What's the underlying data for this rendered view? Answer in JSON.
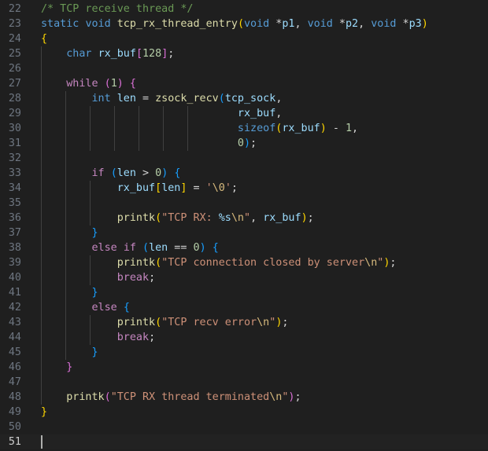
{
  "editor": {
    "language": "C",
    "cursor_line": 51,
    "lines": [
      {
        "number": "22",
        "tokens": [
          {
            "t": "/* TCP receive thread */",
            "c": "c"
          }
        ]
      },
      {
        "number": "23",
        "tokens": [
          {
            "t": "static",
            "c": "k"
          },
          {
            "t": " ",
            "c": "p"
          },
          {
            "t": "void",
            "c": "k"
          },
          {
            "t": " ",
            "c": "p"
          },
          {
            "t": "tcp_rx_thread_entry",
            "c": "f"
          },
          {
            "t": "(",
            "c": "b1"
          },
          {
            "t": "void",
            "c": "k"
          },
          {
            "t": " *",
            "c": "p"
          },
          {
            "t": "p1",
            "c": "v"
          },
          {
            "t": ", ",
            "c": "p"
          },
          {
            "t": "void",
            "c": "k"
          },
          {
            "t": " *",
            "c": "p"
          },
          {
            "t": "p2",
            "c": "v"
          },
          {
            "t": ", ",
            "c": "p"
          },
          {
            "t": "void",
            "c": "k"
          },
          {
            "t": " *",
            "c": "p"
          },
          {
            "t": "p3",
            "c": "v"
          },
          {
            "t": ")",
            "c": "b1"
          }
        ]
      },
      {
        "number": "24",
        "tokens": [
          {
            "t": "{",
            "c": "b1"
          }
        ]
      },
      {
        "number": "25",
        "tokens": [
          {
            "t": "    ",
            "c": "p"
          },
          {
            "t": "char",
            "c": "k"
          },
          {
            "t": " ",
            "c": "p"
          },
          {
            "t": "rx_buf",
            "c": "v"
          },
          {
            "t": "[",
            "c": "b2"
          },
          {
            "t": "128",
            "c": "n"
          },
          {
            "t": "]",
            "c": "b2"
          },
          {
            "t": ";",
            "c": "p"
          }
        ]
      },
      {
        "number": "26",
        "tokens": []
      },
      {
        "number": "27",
        "tokens": [
          {
            "t": "    ",
            "c": "p"
          },
          {
            "t": "while",
            "c": "ctl"
          },
          {
            "t": " ",
            "c": "p"
          },
          {
            "t": "(",
            "c": "b2"
          },
          {
            "t": "1",
            "c": "n"
          },
          {
            "t": ")",
            "c": "b2"
          },
          {
            "t": " ",
            "c": "p"
          },
          {
            "t": "{",
            "c": "b2"
          }
        ]
      },
      {
        "number": "28",
        "tokens": [
          {
            "t": "        ",
            "c": "p"
          },
          {
            "t": "int",
            "c": "k"
          },
          {
            "t": " ",
            "c": "p"
          },
          {
            "t": "len",
            "c": "v"
          },
          {
            "t": " = ",
            "c": "p"
          },
          {
            "t": "zsock_recv",
            "c": "f"
          },
          {
            "t": "(",
            "c": "b3"
          },
          {
            "t": "tcp_sock",
            "c": "v"
          },
          {
            "t": ",",
            "c": "p"
          }
        ]
      },
      {
        "number": "29",
        "tokens": [
          {
            "t": "                               ",
            "c": "p"
          },
          {
            "t": "rx_buf",
            "c": "v"
          },
          {
            "t": ",",
            "c": "p"
          }
        ]
      },
      {
        "number": "30",
        "tokens": [
          {
            "t": "                               ",
            "c": "p"
          },
          {
            "t": "sizeof",
            "c": "k"
          },
          {
            "t": "(",
            "c": "b1"
          },
          {
            "t": "rx_buf",
            "c": "v"
          },
          {
            "t": ")",
            "c": "b1"
          },
          {
            "t": " - ",
            "c": "p"
          },
          {
            "t": "1",
            "c": "n"
          },
          {
            "t": ",",
            "c": "p"
          }
        ]
      },
      {
        "number": "31",
        "tokens": [
          {
            "t": "                               ",
            "c": "p"
          },
          {
            "t": "0",
            "c": "n"
          },
          {
            "t": ")",
            "c": "b3"
          },
          {
            "t": ";",
            "c": "p"
          }
        ]
      },
      {
        "number": "32",
        "tokens": []
      },
      {
        "number": "33",
        "tokens": [
          {
            "t": "        ",
            "c": "p"
          },
          {
            "t": "if",
            "c": "ctl"
          },
          {
            "t": " ",
            "c": "p"
          },
          {
            "t": "(",
            "c": "b3"
          },
          {
            "t": "len",
            "c": "v"
          },
          {
            "t": " > ",
            "c": "p"
          },
          {
            "t": "0",
            "c": "n"
          },
          {
            "t": ")",
            "c": "b3"
          },
          {
            "t": " ",
            "c": "p"
          },
          {
            "t": "{",
            "c": "b3"
          }
        ]
      },
      {
        "number": "34",
        "tokens": [
          {
            "t": "            ",
            "c": "p"
          },
          {
            "t": "rx_buf",
            "c": "v"
          },
          {
            "t": "[",
            "c": "b1"
          },
          {
            "t": "len",
            "c": "v"
          },
          {
            "t": "]",
            "c": "b1"
          },
          {
            "t": " = ",
            "c": "p"
          },
          {
            "t": "'",
            "c": "s"
          },
          {
            "t": "\\0",
            "c": "e"
          },
          {
            "t": "'",
            "c": "s"
          },
          {
            "t": ";",
            "c": "p"
          }
        ]
      },
      {
        "number": "35",
        "tokens": []
      },
      {
        "number": "36",
        "tokens": [
          {
            "t": "            ",
            "c": "p"
          },
          {
            "t": "printk",
            "c": "f"
          },
          {
            "t": "(",
            "c": "b1"
          },
          {
            "t": "\"TCP RX: ",
            "c": "s"
          },
          {
            "t": "%s",
            "c": "v"
          },
          {
            "t": "\\n",
            "c": "e"
          },
          {
            "t": "\"",
            "c": "s"
          },
          {
            "t": ", ",
            "c": "p"
          },
          {
            "t": "rx_buf",
            "c": "v"
          },
          {
            "t": ")",
            "c": "b1"
          },
          {
            "t": ";",
            "c": "p"
          }
        ]
      },
      {
        "number": "37",
        "tokens": [
          {
            "t": "        ",
            "c": "p"
          },
          {
            "t": "}",
            "c": "b3"
          }
        ]
      },
      {
        "number": "38",
        "tokens": [
          {
            "t": "        ",
            "c": "p"
          },
          {
            "t": "else",
            "c": "ctl"
          },
          {
            "t": " ",
            "c": "p"
          },
          {
            "t": "if",
            "c": "ctl"
          },
          {
            "t": " ",
            "c": "p"
          },
          {
            "t": "(",
            "c": "b3"
          },
          {
            "t": "len",
            "c": "v"
          },
          {
            "t": " == ",
            "c": "p"
          },
          {
            "t": "0",
            "c": "n"
          },
          {
            "t": ")",
            "c": "b3"
          },
          {
            "t": " ",
            "c": "p"
          },
          {
            "t": "{",
            "c": "b3"
          }
        ]
      },
      {
        "number": "39",
        "tokens": [
          {
            "t": "            ",
            "c": "p"
          },
          {
            "t": "printk",
            "c": "f"
          },
          {
            "t": "(",
            "c": "b1"
          },
          {
            "t": "\"TCP connection closed by server",
            "c": "s"
          },
          {
            "t": "\\n",
            "c": "e"
          },
          {
            "t": "\"",
            "c": "s"
          },
          {
            "t": ")",
            "c": "b1"
          },
          {
            "t": ";",
            "c": "p"
          }
        ]
      },
      {
        "number": "40",
        "tokens": [
          {
            "t": "            ",
            "c": "p"
          },
          {
            "t": "break",
            "c": "ctl"
          },
          {
            "t": ";",
            "c": "p"
          }
        ]
      },
      {
        "number": "41",
        "tokens": [
          {
            "t": "        ",
            "c": "p"
          },
          {
            "t": "}",
            "c": "b3"
          }
        ]
      },
      {
        "number": "42",
        "tokens": [
          {
            "t": "        ",
            "c": "p"
          },
          {
            "t": "else",
            "c": "ctl"
          },
          {
            "t": " ",
            "c": "p"
          },
          {
            "t": "{",
            "c": "b3"
          }
        ]
      },
      {
        "number": "43",
        "tokens": [
          {
            "t": "            ",
            "c": "p"
          },
          {
            "t": "printk",
            "c": "f"
          },
          {
            "t": "(",
            "c": "b1"
          },
          {
            "t": "\"TCP recv error",
            "c": "s"
          },
          {
            "t": "\\n",
            "c": "e"
          },
          {
            "t": "\"",
            "c": "s"
          },
          {
            "t": ")",
            "c": "b1"
          },
          {
            "t": ";",
            "c": "p"
          }
        ]
      },
      {
        "number": "44",
        "tokens": [
          {
            "t": "            ",
            "c": "p"
          },
          {
            "t": "break",
            "c": "ctl"
          },
          {
            "t": ";",
            "c": "p"
          }
        ]
      },
      {
        "number": "45",
        "tokens": [
          {
            "t": "        ",
            "c": "p"
          },
          {
            "t": "}",
            "c": "b3"
          }
        ]
      },
      {
        "number": "46",
        "tokens": [
          {
            "t": "    ",
            "c": "p"
          },
          {
            "t": "}",
            "c": "b2"
          }
        ]
      },
      {
        "number": "47",
        "tokens": []
      },
      {
        "number": "48",
        "tokens": [
          {
            "t": "    ",
            "c": "p"
          },
          {
            "t": "printk",
            "c": "f"
          },
          {
            "t": "(",
            "c": "b2"
          },
          {
            "t": "\"TCP RX thread terminated",
            "c": "s"
          },
          {
            "t": "\\n",
            "c": "e"
          },
          {
            "t": "\"",
            "c": "s"
          },
          {
            "t": ")",
            "c": "b2"
          },
          {
            "t": ";",
            "c": "p"
          }
        ]
      },
      {
        "number": "49",
        "tokens": [
          {
            "t": "}",
            "c": "b1"
          }
        ]
      },
      {
        "number": "50",
        "tokens": []
      },
      {
        "number": "51",
        "tokens": []
      }
    ]
  },
  "colors": {
    "background": "#1f1f1f",
    "current_line": "#222222",
    "comment": "#6a9955",
    "keyword": "#569cd6",
    "control": "#c586c0",
    "function": "#dcdcaa",
    "variable": "#9cdcfe",
    "number": "#b5cea8",
    "string": "#ce9178",
    "escape": "#d7ba7d",
    "bracket_1": "#ffd700",
    "bracket_2": "#da70d6",
    "bracket_3": "#179fff"
  }
}
